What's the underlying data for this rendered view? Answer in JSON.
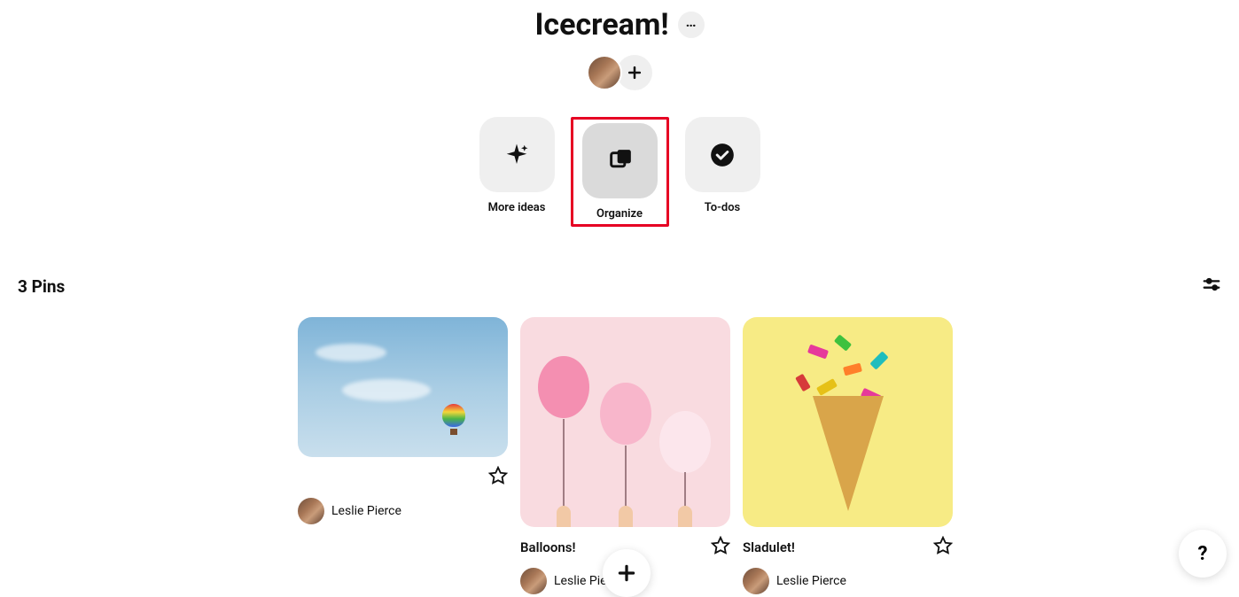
{
  "board": {
    "title": "Icecream!"
  },
  "actions": {
    "more_ideas": "More ideas",
    "organize": "Organize",
    "todos": "To-dos"
  },
  "pins_bar": {
    "count_text": "3 Pins"
  },
  "pins": [
    {
      "title": "",
      "author": "Leslie Pierce"
    },
    {
      "title": "Balloons!",
      "author": "Leslie Pierce"
    },
    {
      "title": "Sladulet!",
      "author": "Leslie Pierce"
    }
  ],
  "help_label": "?"
}
